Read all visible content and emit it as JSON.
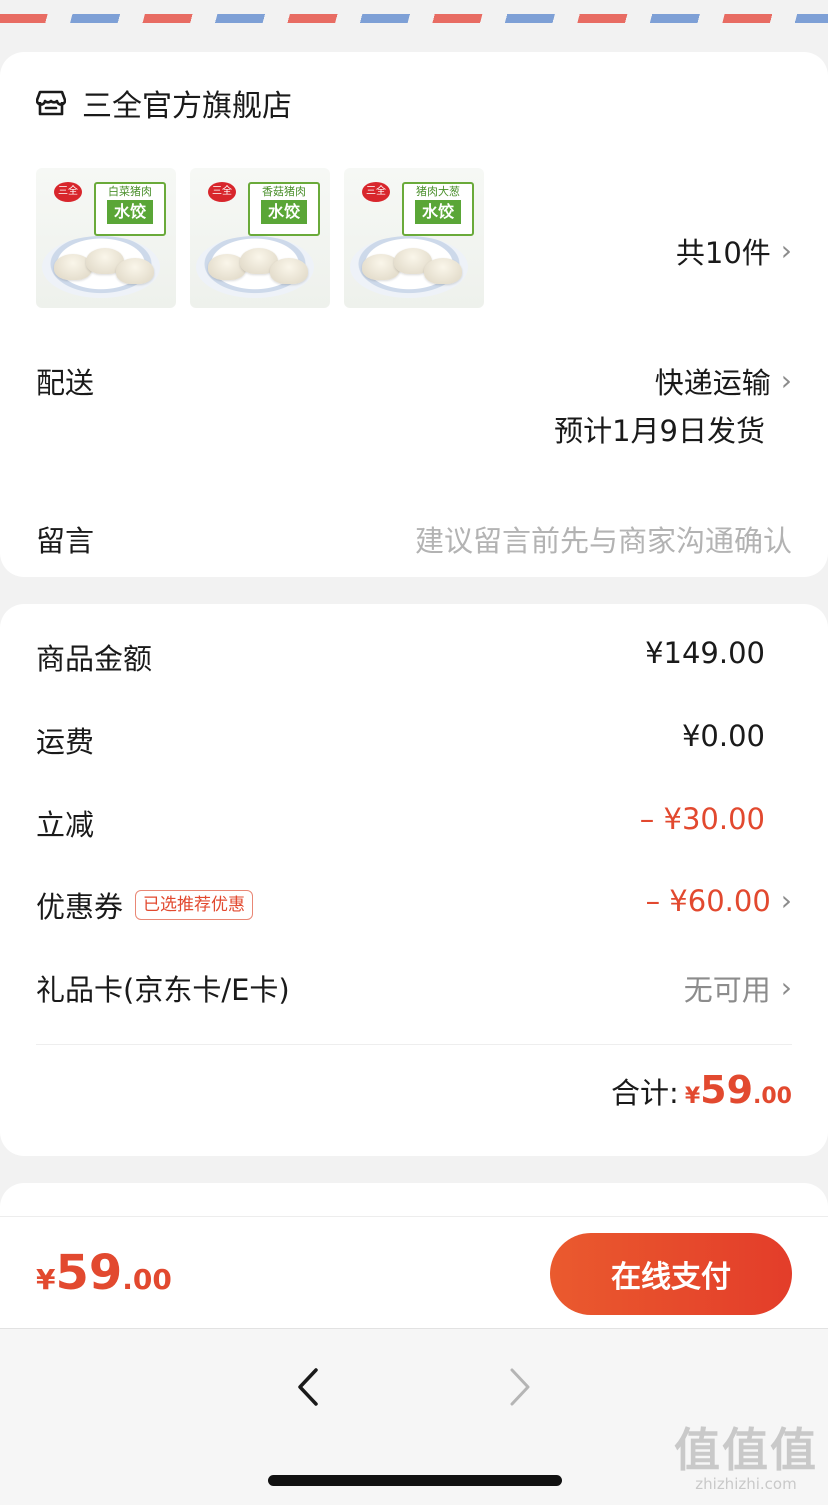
{
  "store": {
    "name": "三全官方旗舰店",
    "icon": "store-icon",
    "products": [
      {
        "brand": "三全",
        "subtitle": "白菜猪肉",
        "name": "水饺"
      },
      {
        "brand": "三全",
        "subtitle": "香菇猪肉",
        "name": "水饺"
      },
      {
        "brand": "三全",
        "subtitle": "猪肉大葱",
        "name": "水饺"
      }
    ],
    "count_text": "共10件"
  },
  "delivery": {
    "label": "配送",
    "method": "快递运输",
    "ship_date": "预计1月9日发货"
  },
  "message": {
    "label": "留言",
    "placeholder": "建议留言前先与商家沟通确认"
  },
  "pricing": {
    "goods_label": "商品金额",
    "goods_value": "¥149.00",
    "shipping_label": "运费",
    "shipping_value": "¥0.00",
    "discount_label": "立减",
    "discount_value": "– ¥30.00",
    "coupon_label": "优惠券",
    "coupon_badge": "已选推荐优惠",
    "coupon_value": "– ¥60.00",
    "giftcard_label": "礼品卡(京东卡/E卡)",
    "giftcard_value": "无可用",
    "total_label": "合计:",
    "total_yen": "¥",
    "total_int": "59",
    "total_dec": ".00"
  },
  "bottom": {
    "yen": "¥",
    "amount_int": "59",
    "amount_dec": ".00",
    "pay_label": "在线支付"
  },
  "watermark": {
    "text": "值值值",
    "domain": "zhizhizhi.com"
  },
  "colors": {
    "accent_red": "#e2492f",
    "stripe_red": "#e86c63",
    "stripe_blue": "#7ea0d6"
  }
}
